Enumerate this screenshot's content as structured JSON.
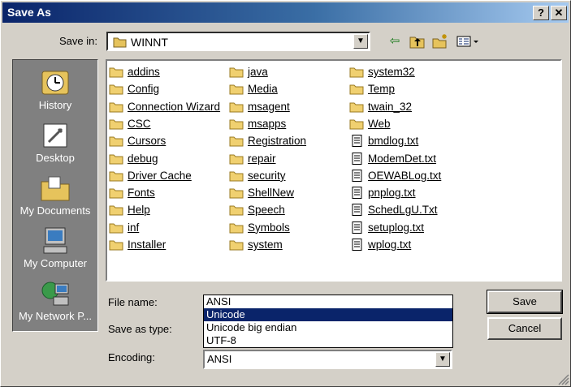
{
  "window": {
    "title": "Save As",
    "help_btn": "?",
    "close_btn": "✕"
  },
  "save_in": {
    "label": "Save in:",
    "value": "WINNT"
  },
  "toolbar": {
    "back": "⇦",
    "up_folder": "up-folder-icon",
    "new_folder": "new-folder-icon",
    "view_menu": "view-menu-icon"
  },
  "places": [
    {
      "label": "History",
      "icon": "history-icon"
    },
    {
      "label": "Desktop",
      "icon": "desktop-icon"
    },
    {
      "label": "My Documents",
      "icon": "my-documents-icon"
    },
    {
      "label": "My Computer",
      "icon": "my-computer-icon"
    },
    {
      "label": "My Network P...",
      "icon": "my-network-places-icon"
    }
  ],
  "files": {
    "col1": [
      "addins",
      "Config",
      "Connection Wizard",
      "CSC",
      "Cursors",
      "debug",
      "Driver Cache",
      "Fonts",
      "Help",
      "inf",
      "Installer"
    ],
    "col2": [
      "java",
      "Media",
      "msagent",
      "msapps",
      "Registration",
      "repair",
      "security",
      "ShellNew",
      "Speech",
      "Symbols",
      "system"
    ],
    "col3": [
      {
        "name": "system32",
        "type": "folder"
      },
      {
        "name": "Temp",
        "type": "folder"
      },
      {
        "name": "twain_32",
        "type": "folder"
      },
      {
        "name": "Web",
        "type": "folder"
      },
      {
        "name": "bmdlog.txt",
        "type": "file"
      },
      {
        "name": "ModemDet.txt",
        "type": "file"
      },
      {
        "name": "OEWABLog.txt",
        "type": "file"
      },
      {
        "name": "pnplog.txt",
        "type": "file"
      },
      {
        "name": "SchedLgU.Txt",
        "type": "file"
      },
      {
        "name": "setuplog.txt",
        "type": "file"
      },
      {
        "name": "wplog.txt",
        "type": "file"
      }
    ]
  },
  "form": {
    "file_name_label": "File name:",
    "save_type_label": "Save as type:",
    "encoding_label": "Encoding:",
    "encoding_value": "ANSI",
    "encoding_options": [
      "ANSI",
      "Unicode",
      "Unicode big endian",
      "UTF-8"
    ],
    "highlighted_option": "Unicode"
  },
  "buttons": {
    "save": "Save",
    "cancel": "Cancel"
  },
  "colors": {
    "title_start": "#0a246a",
    "title_end": "#a6caf0",
    "selection": "#0a246a",
    "face": "#d4d0c8"
  }
}
